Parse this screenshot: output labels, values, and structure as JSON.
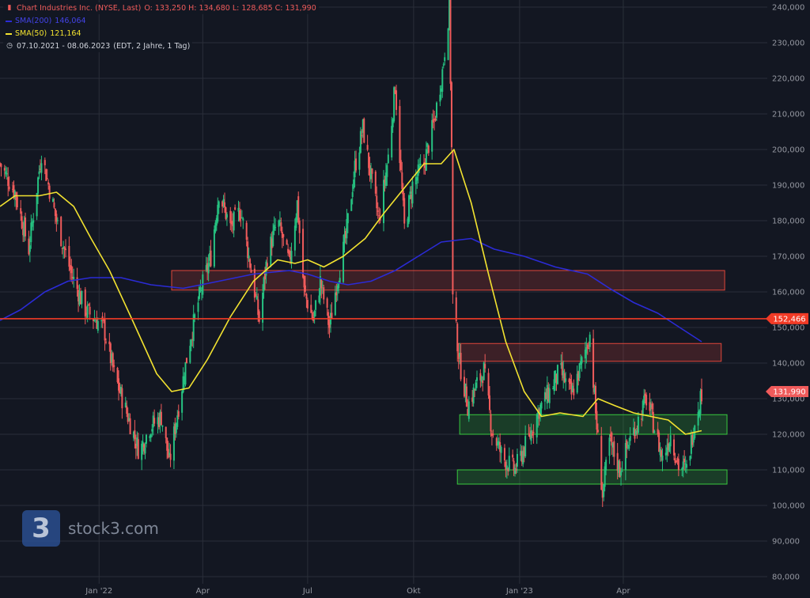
{
  "legend": {
    "title": "Chart Industries Inc. (NYSE, Last)",
    "ohlc": "O: 133,250  H: 134,680  L: 128,685  C: 131,990",
    "sma200_label": "SMA(200)",
    "sma200_value": "146,064",
    "sma50_label": "SMA(50)",
    "sma50_value": "121,164",
    "range": "07.10.2021 - 08.06.2023",
    "range_note": "(EDT, 2 Jahre, 1 Tag)",
    "title_color": "#f05b5b",
    "sma200_color": "#2b2bd6",
    "sma50_color": "#f2e230",
    "price_color": "#f05b5b"
  },
  "watermark": {
    "badge": "3",
    "text": "stock3.com"
  },
  "chart_data": {
    "type": "candlestick",
    "x_axis": {
      "range": [
        "2021-10-07",
        "2023-06-08"
      ],
      "ticks": [
        {
          "date": "2022-01-01",
          "label": "Jan '22"
        },
        {
          "date": "2022-04-01",
          "label": "Apr"
        },
        {
          "date": "2022-07-01",
          "label": "Jul"
        },
        {
          "date": "2022-10-01",
          "label": "Okt"
        },
        {
          "date": "2023-01-01",
          "label": "Jan '23"
        },
        {
          "date": "2023-04-01",
          "label": "Apr"
        }
      ]
    },
    "y_axis": {
      "ylim": [
        78,
        242
      ],
      "ticks": [
        240,
        230,
        220,
        210,
        200,
        190,
        180,
        170,
        160,
        150,
        140,
        130,
        120,
        110,
        100,
        90,
        80
      ],
      "tick_labels": [
        "240,000",
        "230,000",
        "220,000",
        "210,000",
        "200,000",
        "190,000",
        "180,000",
        "170,000",
        "160,000",
        "150,000",
        "140,000",
        "130,000",
        "120,000",
        "110,000",
        "100,000",
        "90,000",
        "80,000"
      ],
      "position": "right"
    },
    "grid": true,
    "price_path": [
      [
        "2021-10-07",
        196
      ],
      [
        "2021-10-20",
        188
      ],
      [
        "2021-11-01",
        172
      ],
      [
        "2021-11-12",
        199
      ],
      [
        "2021-11-25",
        180
      ],
      [
        "2021-12-08",
        165
      ],
      [
        "2021-12-20",
        155
      ],
      [
        "2022-01-05",
        150
      ],
      [
        "2022-01-14",
        137
      ],
      [
        "2022-01-25",
        126
      ],
      [
        "2022-02-05",
        115
      ],
      [
        "2022-02-14",
        122
      ],
      [
        "2022-02-24",
        125
      ],
      [
        "2022-03-03",
        112
      ],
      [
        "2022-03-10",
        126
      ],
      [
        "2022-03-20",
        145
      ],
      [
        "2022-03-30",
        160
      ],
      [
        "2022-04-08",
        170
      ],
      [
        "2022-04-15",
        188
      ],
      [
        "2022-04-25",
        178
      ],
      [
        "2022-05-04",
        183
      ],
      [
        "2022-05-12",
        168
      ],
      [
        "2022-05-20",
        152
      ],
      [
        "2022-05-27",
        170
      ],
      [
        "2022-06-05",
        180
      ],
      [
        "2022-06-15",
        168
      ],
      [
        "2022-06-22",
        185
      ],
      [
        "2022-06-28",
        160
      ],
      [
        "2022-07-06",
        152
      ],
      [
        "2022-07-12",
        163
      ],
      [
        "2022-07-20",
        150
      ],
      [
        "2022-07-26",
        162
      ],
      [
        "2022-08-03",
        175
      ],
      [
        "2022-08-11",
        195
      ],
      [
        "2022-08-18",
        206
      ],
      [
        "2022-08-25",
        192
      ],
      [
        "2022-09-01",
        180
      ],
      [
        "2022-09-09",
        198
      ],
      [
        "2022-09-15",
        218
      ],
      [
        "2022-09-23",
        178
      ],
      [
        "2022-09-30",
        190
      ],
      [
        "2022-10-10",
        196
      ],
      [
        "2022-10-19",
        208
      ],
      [
        "2022-10-26",
        222
      ],
      [
        "2022-11-01",
        240
      ],
      [
        "2022-11-03",
        200
      ],
      [
        "2022-11-04",
        158
      ],
      [
        "2022-11-10",
        140
      ],
      [
        "2022-11-17",
        128
      ],
      [
        "2022-11-25",
        134
      ],
      [
        "2022-12-01",
        138
      ],
      [
        "2022-12-08",
        121
      ],
      [
        "2022-12-18",
        113
      ],
      [
        "2022-12-28",
        110
      ],
      [
        "2023-01-09",
        119
      ],
      [
        "2023-01-18",
        127
      ],
      [
        "2023-01-27",
        132
      ],
      [
        "2023-02-05",
        138
      ],
      [
        "2023-02-15",
        131
      ],
      [
        "2023-02-24",
        140
      ],
      [
        "2023-03-03",
        148
      ],
      [
        "2023-03-08",
        126
      ],
      [
        "2023-03-14",
        103
      ],
      [
        "2023-03-20",
        118
      ],
      [
        "2023-03-29",
        110
      ],
      [
        "2023-04-06",
        118
      ],
      [
        "2023-04-14",
        124
      ],
      [
        "2023-04-21",
        130
      ],
      [
        "2023-04-28",
        122
      ],
      [
        "2023-05-05",
        113
      ],
      [
        "2023-05-12",
        120
      ],
      [
        "2023-05-19",
        111
      ],
      [
        "2023-05-26",
        110
      ],
      [
        "2023-06-02",
        124
      ],
      [
        "2023-06-08",
        132
      ]
    ],
    "series": [
      {
        "name": "SMA(200)",
        "color": "#2b2bd6",
        "points": [
          [
            "2021-10-07",
            152
          ],
          [
            "2021-10-25",
            155
          ],
          [
            "2021-11-15",
            160
          ],
          [
            "2021-12-05",
            163
          ],
          [
            "2021-12-25",
            164
          ],
          [
            "2022-01-20",
            164
          ],
          [
            "2022-02-15",
            162
          ],
          [
            "2022-03-15",
            161
          ],
          [
            "2022-04-15",
            163
          ],
          [
            "2022-05-15",
            165
          ],
          [
            "2022-06-15",
            166
          ],
          [
            "2022-07-01",
            165
          ],
          [
            "2022-07-20",
            163
          ],
          [
            "2022-08-05",
            162
          ],
          [
            "2022-08-25",
            163
          ],
          [
            "2022-09-15",
            166
          ],
          [
            "2022-10-05",
            170
          ],
          [
            "2022-10-25",
            174
          ],
          [
            "2022-11-20",
            175
          ],
          [
            "2022-12-10",
            172
          ],
          [
            "2023-01-05",
            170
          ],
          [
            "2023-02-01",
            167
          ],
          [
            "2023-03-01",
            165
          ],
          [
            "2023-03-20",
            161
          ],
          [
            "2023-04-10",
            157
          ],
          [
            "2023-05-01",
            154
          ],
          [
            "2023-05-20",
            150
          ],
          [
            "2023-06-08",
            146
          ]
        ]
      },
      {
        "name": "SMA(50)",
        "color": "#f2e230",
        "points": [
          [
            "2021-10-07",
            184
          ],
          [
            "2021-10-20",
            187
          ],
          [
            "2021-11-10",
            187
          ],
          [
            "2021-11-25",
            188
          ],
          [
            "2021-12-10",
            184
          ],
          [
            "2021-12-25",
            175
          ],
          [
            "2022-01-10",
            166
          ],
          [
            "2022-01-30",
            152
          ],
          [
            "2022-02-20",
            137
          ],
          [
            "2022-03-05",
            132
          ],
          [
            "2022-03-20",
            133
          ],
          [
            "2022-04-05",
            141
          ],
          [
            "2022-04-25",
            153
          ],
          [
            "2022-05-15",
            163
          ],
          [
            "2022-06-05",
            169
          ],
          [
            "2022-06-20",
            168
          ],
          [
            "2022-07-01",
            169
          ],
          [
            "2022-07-15",
            167
          ],
          [
            "2022-08-01",
            170
          ],
          [
            "2022-08-20",
            175
          ],
          [
            "2022-09-05",
            182
          ],
          [
            "2022-09-25",
            190
          ],
          [
            "2022-10-10",
            196
          ],
          [
            "2022-10-25",
            196
          ],
          [
            "2022-11-05",
            200
          ],
          [
            "2022-11-20",
            185
          ],
          [
            "2022-12-05",
            165
          ],
          [
            "2022-12-20",
            146
          ],
          [
            "2023-01-05",
            132
          ],
          [
            "2023-01-20",
            125
          ],
          [
            "2023-02-05",
            126
          ],
          [
            "2023-02-25",
            125
          ],
          [
            "2023-03-10",
            130
          ],
          [
            "2023-03-25",
            128
          ],
          [
            "2023-04-10",
            126
          ],
          [
            "2023-04-25",
            125
          ],
          [
            "2023-05-10",
            124
          ],
          [
            "2023-05-25",
            120
          ],
          [
            "2023-06-08",
            121
          ]
        ]
      }
    ],
    "horizontal_line": {
      "value": 152.466,
      "label": "152,466",
      "color": "#f23b26"
    },
    "last_price": {
      "value": 131.99,
      "label": "131,990",
      "color": "#f05b5b"
    },
    "zones": [
      {
        "type": "resistance",
        "from": "2022-03-05",
        "to": "2023-06-28",
        "y_low": 160.5,
        "y_high": 166,
        "color": "#e0463a"
      },
      {
        "type": "resistance",
        "from": "2022-11-08",
        "to": "2023-06-25",
        "y_low": 140.5,
        "y_high": 145.5,
        "color": "#e0463a"
      },
      {
        "type": "support",
        "from": "2022-11-10",
        "to": "2023-06-30",
        "y_low": 120,
        "y_high": 125.5,
        "color": "#38c93e"
      },
      {
        "type": "support",
        "from": "2022-11-08",
        "to": "2023-06-30",
        "y_low": 106,
        "y_high": 110,
        "color": "#38c93e"
      }
    ],
    "candle_colors": {
      "up": "#26c281",
      "down": "#f05b5b"
    }
  }
}
